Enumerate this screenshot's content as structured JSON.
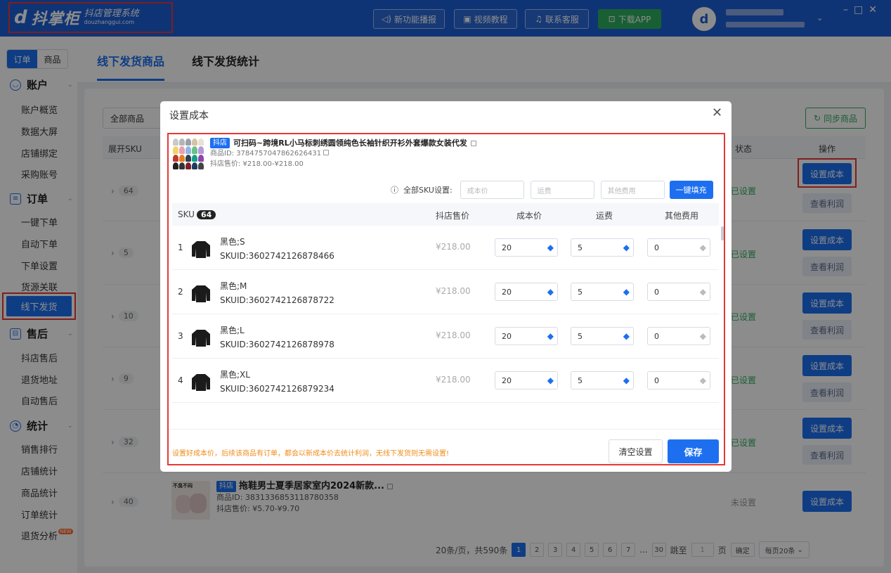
{
  "titlebar": {
    "logo_mark": "d",
    "app_name": "抖掌柜",
    "app_subtitle": "抖店管理系统",
    "app_domain": "douzhanggui.com",
    "buttons": {
      "news": "新功能播报",
      "video": "视频教程",
      "support": "联系客服",
      "download": "下载APP"
    },
    "avatar_letter": "d"
  },
  "sidebar": {
    "mode_tabs": [
      "订单",
      "商品"
    ],
    "groups": {
      "account": "账户",
      "order": "订单",
      "aftersale": "售后",
      "stats": "统计"
    },
    "account_items": [
      "账户概览",
      "数据大屏",
      "店铺绑定",
      "采购账号"
    ],
    "order_items": [
      "一键下单",
      "自动下单",
      "下单设置",
      "货源关联"
    ],
    "order_active": "线下发货",
    "aftersale_items": [
      "抖店售后",
      "退货地址",
      "自动售后"
    ],
    "stats_items": [
      "销售排行",
      "店铺统计",
      "商品统计",
      "订单统计"
    ],
    "stats_last": "退货分析",
    "new_badge": "NEW"
  },
  "page_tabs": [
    "线下发货商品",
    "线下发货统计"
  ],
  "list": {
    "filter_value": "全部商品",
    "sync_label": "同步商品",
    "headers": {
      "expand": "展开SKU",
      "status": "状态",
      "action": "操作"
    },
    "rows": [
      {
        "count": "64",
        "status": "已设置"
      },
      {
        "count": "5",
        "status": "已设置"
      },
      {
        "count": "10",
        "status": "已设置"
      },
      {
        "count": "9",
        "status": "已设置"
      },
      {
        "count": "32",
        "status": "已设置"
      },
      {
        "count": "40",
        "status": "未设置"
      }
    ],
    "set_cost_label": "设置成本",
    "view_profit_label": "查看利润",
    "bg_product": {
      "thumb_text": "不臭不闷",
      "shop_tag": "抖店",
      "title": "拖鞋男士夏季居家室内2024新款...",
      "id_line": "商品ID: 3831336853118780358",
      "price_line": "抖店售价: ¥5.70-¥9.70"
    }
  },
  "pager": {
    "summary": "20条/页，共590条",
    "pages": [
      "1",
      "2",
      "3",
      "4",
      "5",
      "6",
      "7"
    ],
    "ellipsis": "...",
    "last": "30",
    "jump_label": "跳至",
    "jump_value": "1",
    "page_unit": "页",
    "confirm": "确定",
    "per_page": "每页20条"
  },
  "modal": {
    "title": "设置成本",
    "product": {
      "shop_tag": "抖店",
      "title": "可扫码~跨境RL小马标刺绣圆领纯色长袖针织开衫外套爆款女装代发",
      "id_line": "商品ID: 3784757047862626431",
      "price_line": "抖店售价: ¥218.00-¥218.00"
    },
    "all_sku_label": "全部SKU设置:",
    "placeholders": {
      "cost": "成本价",
      "shipping": "运费",
      "other": "其他费用"
    },
    "fill_button": "一键填充",
    "table_headers": {
      "sku": "SKU",
      "price": "抖店售价",
      "cost": "成本价",
      "shipping": "运费",
      "other": "其他费用"
    },
    "sku_count": "64",
    "skus": [
      {
        "idx": "1",
        "name": "黑色;S",
        "skuid": "SKUID:3602742126878466",
        "price": "¥218.00",
        "cost": "20",
        "shipping": "5",
        "other": "0"
      },
      {
        "idx": "2",
        "name": "黑色;M",
        "skuid": "SKUID:3602742126878722",
        "price": "¥218.00",
        "cost": "20",
        "shipping": "5",
        "other": "0"
      },
      {
        "idx": "3",
        "name": "黑色;L",
        "skuid": "SKUID:3602742126878978",
        "price": "¥218.00",
        "cost": "20",
        "shipping": "5",
        "other": "0"
      },
      {
        "idx": "4",
        "name": "黑色;XL",
        "skuid": "SKUID:3602742126879234",
        "price": "¥218.00",
        "cost": "20",
        "shipping": "5",
        "other": "0"
      }
    ],
    "tip": "设置好成本价，后续该商品有订单，都会以新成本价去统计利润，无线下发货则无需设置!",
    "clear_label": "清空设置",
    "save_label": "保存"
  },
  "colors": {
    "primary": "#1d6ff0",
    "titlebar": "#1d5fd6",
    "success": "#2eae5f",
    "warning": "#f08c1a",
    "highlight": "#e53935"
  }
}
